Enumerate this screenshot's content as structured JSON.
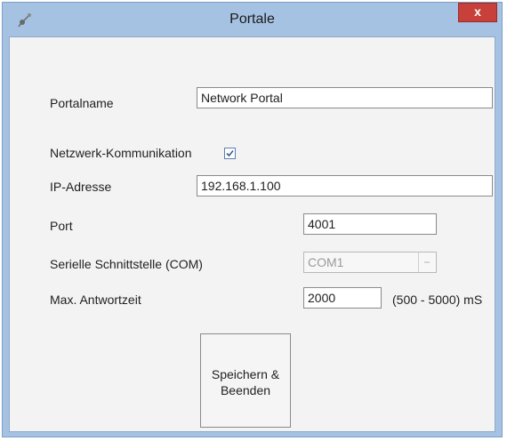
{
  "window": {
    "title": "Portale",
    "close_label": "x"
  },
  "form": {
    "portalname": {
      "label": "Portalname",
      "value": "Network Portal"
    },
    "network": {
      "label": "Netzwerk-Kommunikation",
      "checked": true
    },
    "ip": {
      "label": "IP-Adresse",
      "value": "192.168.1.100"
    },
    "port": {
      "label": "Port",
      "value": "4001"
    },
    "serial": {
      "label": "Serielle Schnittstelle (COM)",
      "value": "COM1",
      "enabled": false
    },
    "timeout": {
      "label": "Max. Antwortzeit",
      "value": "2000",
      "range_hint": "(500 - 5000) mS"
    }
  },
  "buttons": {
    "save_line1": "Speichern &",
    "save_line2": "Beenden"
  },
  "colors": {
    "frame": "#a5c2e3",
    "close": "#c7403a",
    "client": "#f3f3f3"
  },
  "icons": {
    "app": "portal-app-icon",
    "checkbox": "checkmark-icon",
    "dropdown": "chevron-down-icon"
  }
}
